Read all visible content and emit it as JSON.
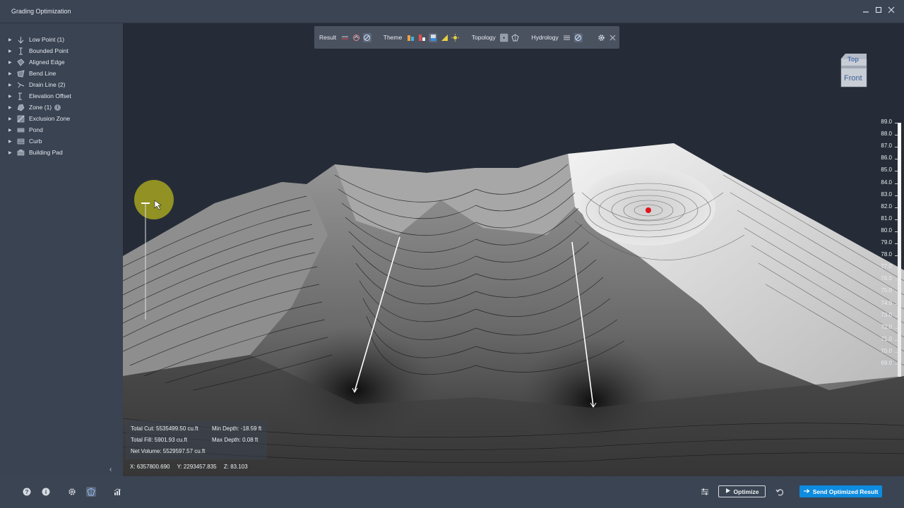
{
  "window": {
    "title": "Grading Optimization"
  },
  "sidebar": {
    "items": [
      {
        "label": "Low Point (1)",
        "icon": "low-point-icon"
      },
      {
        "label": "Bounded Point",
        "icon": "bounded-point-icon"
      },
      {
        "label": "Aligned Edge",
        "icon": "aligned-edge-icon"
      },
      {
        "label": "Bend Line",
        "icon": "bend-line-icon"
      },
      {
        "label": "Drain Line (2)",
        "icon": "drain-line-icon"
      },
      {
        "label": "Elevation Offset",
        "icon": "elevation-offset-icon"
      },
      {
        "label": "Zone (1)",
        "icon": "zone-icon"
      },
      {
        "label": "Exclusion Zone",
        "icon": "exclusion-zone-icon"
      },
      {
        "label": "Pond",
        "icon": "pond-icon"
      },
      {
        "label": "Curb",
        "icon": "curb-icon"
      },
      {
        "label": "Building Pad",
        "icon": "building-pad-icon"
      }
    ]
  },
  "toolbar": {
    "result_label": "Result",
    "theme_label": "Theme",
    "topology_label": "Topology",
    "hydrology_label": "Hydrology"
  },
  "viewcube": {
    "top": "Top",
    "front": "Front"
  },
  "legend": {
    "labels": [
      "89.0",
      "88.0",
      "87.0",
      "86.0",
      "85.0",
      "84.0",
      "83.0",
      "82.0",
      "81.0",
      "80.0",
      "79.0",
      "78.0",
      "77.0",
      "76.0",
      "75.0",
      "74.0",
      "73.0",
      "72.0",
      "71.0",
      "70.0",
      "69.0"
    ]
  },
  "stats": {
    "total_cut": "Total Cut: 5535499.50 cu.ft",
    "min_depth": "Min Depth: -18.59 ft",
    "total_fill": "Total Fill: 5901.93 cu.ft",
    "max_depth": "Max Depth: 0.08 ft",
    "net_volume": "Net Volume: 5529597.57 cu.ft"
  },
  "coords": {
    "x": "X: 6357800.690",
    "y": "Y: 2293457.835",
    "z": "Z: 83.103"
  },
  "bottom": {
    "optimize_label": "Optimize",
    "send_label": "Send Optimized Result"
  },
  "colors": {
    "accent": "#0d8ce0",
    "panel": "#3a4352",
    "viewport": "#262c37",
    "low_point_marker": "#e0141e"
  }
}
